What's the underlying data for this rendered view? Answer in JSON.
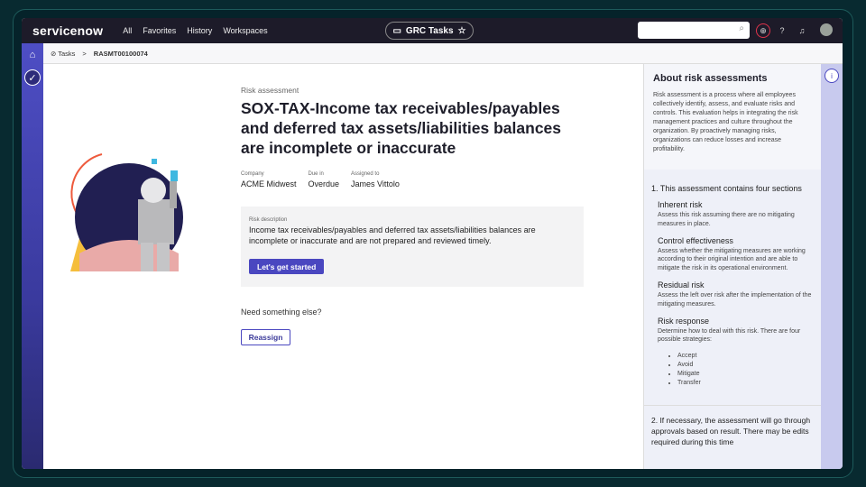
{
  "topnav": {
    "logo": "servicenow",
    "items": [
      "All",
      "Favorites",
      "History",
      "Workspaces"
    ],
    "workspace": "GRC Tasks",
    "star": "☆",
    "search_icon": "⌕"
  },
  "breadcrumb": {
    "parent": "Tasks",
    "sep": ">",
    "current": "RASMT00100074"
  },
  "main": {
    "kicker": "Risk assessment",
    "title": "SOX-TAX-Income tax receivables/payables and deferred tax assets/liabilities balances are incomplete or inaccurate",
    "meta": [
      {
        "label": "Company",
        "value": "ACME Midwest"
      },
      {
        "label": "Due in",
        "value": "Overdue"
      },
      {
        "label": "Assigned to",
        "value": "James Vittolo"
      }
    ],
    "desc_label": "Risk description",
    "desc": "Income tax receivables/payables and deferred tax assets/liabilities balances are incomplete or inaccurate and are not prepared and reviewed timely.",
    "start": "Let's get started",
    "need": "Need something else?",
    "reassign": "Reassign"
  },
  "panel": {
    "title": "About risk assessments",
    "intro": "Risk assessment is a process where all employees collectively identify, assess, and evaluate risks and controls. This evaluation helps in integrating the risk management practices and culture throughout the organization. By proactively managing risks, organizations can reduce losses and increase profitability.",
    "s1": "1. This assessment contains four sections",
    "sections": [
      {
        "h": "Inherent risk",
        "p": "Assess this risk assuming there are no mitigating measures in place."
      },
      {
        "h": "Control effectiveness",
        "p": "Assess whether the mitigating measures are working according to their original intention and are able to mitigate the risk in its operational environment."
      },
      {
        "h": "Residual risk",
        "p": "Assess the left over risk after the implementation of the mitigating measures."
      },
      {
        "h": "Risk response",
        "p": "Determine how to deal with this risk. There are four possible strategies:"
      }
    ],
    "strategies": [
      "Accept",
      "Avoid",
      "Mitigate",
      "Transfer"
    ],
    "s2": "2. If necessary, the assessment will go through approvals based on result. There may be edits required during this time"
  }
}
